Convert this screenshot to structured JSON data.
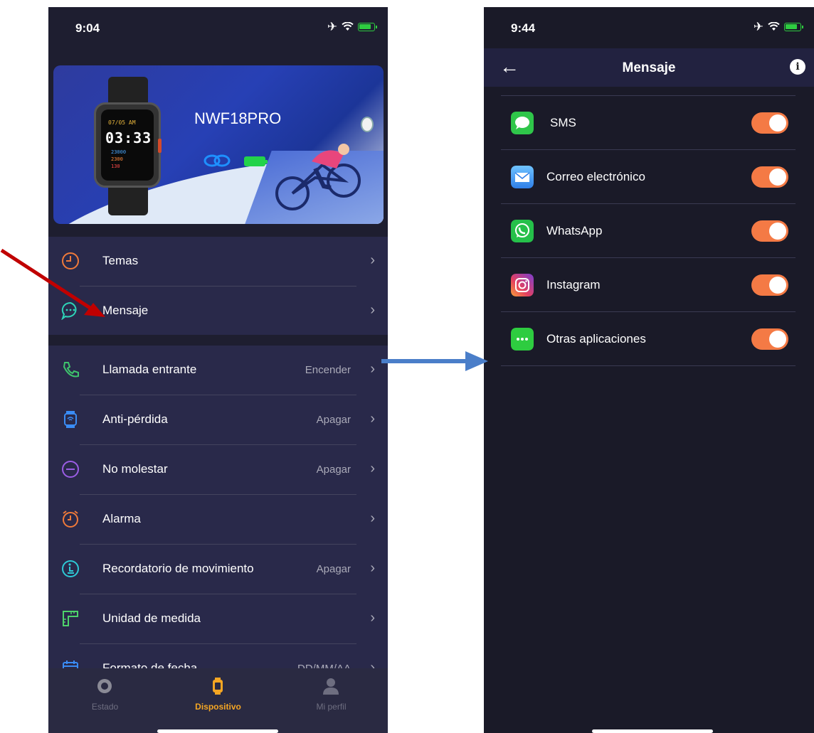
{
  "left_screen": {
    "status": {
      "time": "9:04"
    },
    "device": {
      "name": "NWF18PRO",
      "watch_date": "07/05 AM",
      "watch_time": "03:33",
      "watch_steps": "23000",
      "watch_calories": "2300",
      "watch_heart": "130"
    },
    "group1": [
      {
        "label": "Temas",
        "icon": "clock-icon"
      },
      {
        "label": "Mensaje",
        "icon": "message-icon"
      }
    ],
    "group2": [
      {
        "label": "Llamada entrante",
        "value": "Encender",
        "icon": "phone-icon"
      },
      {
        "label": "Anti-pérdida",
        "value": "Apagar",
        "icon": "watch-signal-icon"
      },
      {
        "label": "No molestar",
        "value": "Apagar",
        "icon": "do-not-disturb-icon"
      },
      {
        "label": "Alarma",
        "value": "",
        "icon": "alarm-icon"
      },
      {
        "label": "Recordatorio de movimiento",
        "value": "Apagar",
        "icon": "movement-icon"
      },
      {
        "label": "Unidad de medida",
        "value": "",
        "icon": "ruler-icon"
      },
      {
        "label": "Formato de fecha",
        "value": "DD/MM/AA",
        "icon": "calendar-icon"
      }
    ],
    "tabs": [
      {
        "label": "Estado",
        "icon": "status-icon",
        "active": false
      },
      {
        "label": "Dispositivo",
        "icon": "watch-icon",
        "active": true
      },
      {
        "label": "Mi perfil",
        "icon": "profile-icon",
        "active": false
      }
    ]
  },
  "right_screen": {
    "status": {
      "time": "9:44"
    },
    "title": "Mensaje",
    "apps": [
      {
        "label": "SMS",
        "icon": "sms-icon",
        "enabled": true,
        "color": "#2fc64a"
      },
      {
        "label": "Correo electrónico",
        "icon": "mail-icon",
        "enabled": true,
        "color": "#3aa0f5"
      },
      {
        "label": "WhatsApp",
        "icon": "whatsapp-icon",
        "enabled": true,
        "color": "#25c04a"
      },
      {
        "label": "Instagram",
        "icon": "instagram-icon",
        "enabled": true,
        "color": "#c13584"
      },
      {
        "label": "Otras aplicaciones",
        "icon": "other-apps-icon",
        "enabled": true,
        "color": "#2ecc40"
      }
    ]
  },
  "colors": {
    "accent": "#f47a45",
    "active_tab": "#f5a623",
    "annotation_red": "#c00000",
    "annotation_blue": "#4a7ec9"
  }
}
